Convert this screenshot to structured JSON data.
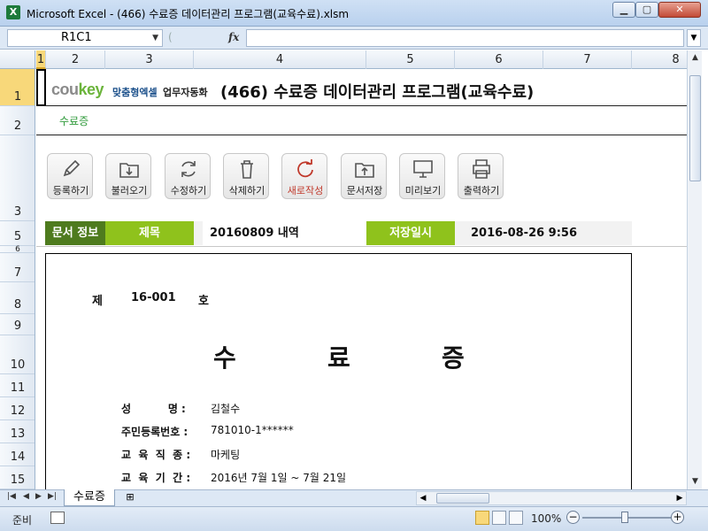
{
  "window": {
    "app_icon": "X",
    "title": "Microsoft Excel - (466) 수료증 데이터관리 프로그램(교육수료).xlsm",
    "min_label": "▁",
    "max_label": "▢",
    "close_label": "✕"
  },
  "formula_bar": {
    "name_box": "R1C1",
    "fx_label": "fx",
    "formula": ""
  },
  "columns": [
    "1",
    "2",
    "3",
    "4",
    "5",
    "6",
    "7",
    "8"
  ],
  "rows": [
    "1",
    "2",
    "3",
    "5",
    "6",
    "7",
    "8",
    "9",
    "10",
    "11",
    "12",
    "13",
    "14",
    "15"
  ],
  "header": {
    "logo_cou": "cou",
    "logo_key": "key",
    "logo_sub1": "맞춤형엑셀",
    "logo_sub2": "업무자동화",
    "title": "(466) 수료증 데이터관리 프로그램(교육수료)",
    "sheet_tag": "수료증"
  },
  "toolbar": {
    "buttons": [
      {
        "label": "등록하기",
        "icon": "pencil-icon"
      },
      {
        "label": "불러오기",
        "icon": "folder-download-icon"
      },
      {
        "label": "수정하기",
        "icon": "refresh-icon"
      },
      {
        "label": "삭제하기",
        "icon": "trash-icon"
      },
      {
        "label": "새로작성",
        "icon": "new-circle-icon"
      },
      {
        "label": "문서저장",
        "icon": "folder-upload-icon"
      },
      {
        "label": "미리보기",
        "icon": "monitor-icon"
      },
      {
        "label": "출력하기",
        "icon": "printer-icon"
      }
    ]
  },
  "info": {
    "doc_info_label": "문서 정보",
    "subject_label": "제목",
    "subject_value": "20160809 내역",
    "saved_label": "저장일시",
    "saved_value": "2016-08-26 9:56"
  },
  "certificate": {
    "no_prefix": "제",
    "no_value": "16-001",
    "no_suffix": "호",
    "title_chars": [
      "수",
      "료",
      "증"
    ],
    "fields": [
      {
        "label": "성          명 :",
        "value": "김철수"
      },
      {
        "label": "주민등록번호 :",
        "value": "781010-1******"
      },
      {
        "label": "교  육  직  종 :",
        "value": "마케팅"
      },
      {
        "label": "교  육  기  간 :",
        "value": "2016년 7월 1일 ~ 7월 21일"
      }
    ]
  },
  "sheet_tabs": {
    "active": "수료증"
  },
  "status": {
    "ready": "준비",
    "zoom": "100%",
    "zoom_level_percent": 100
  },
  "colors": {
    "dark_green": "#4e7b1e",
    "light_green": "#8fc21c",
    "accent_red": "#c0392b"
  }
}
